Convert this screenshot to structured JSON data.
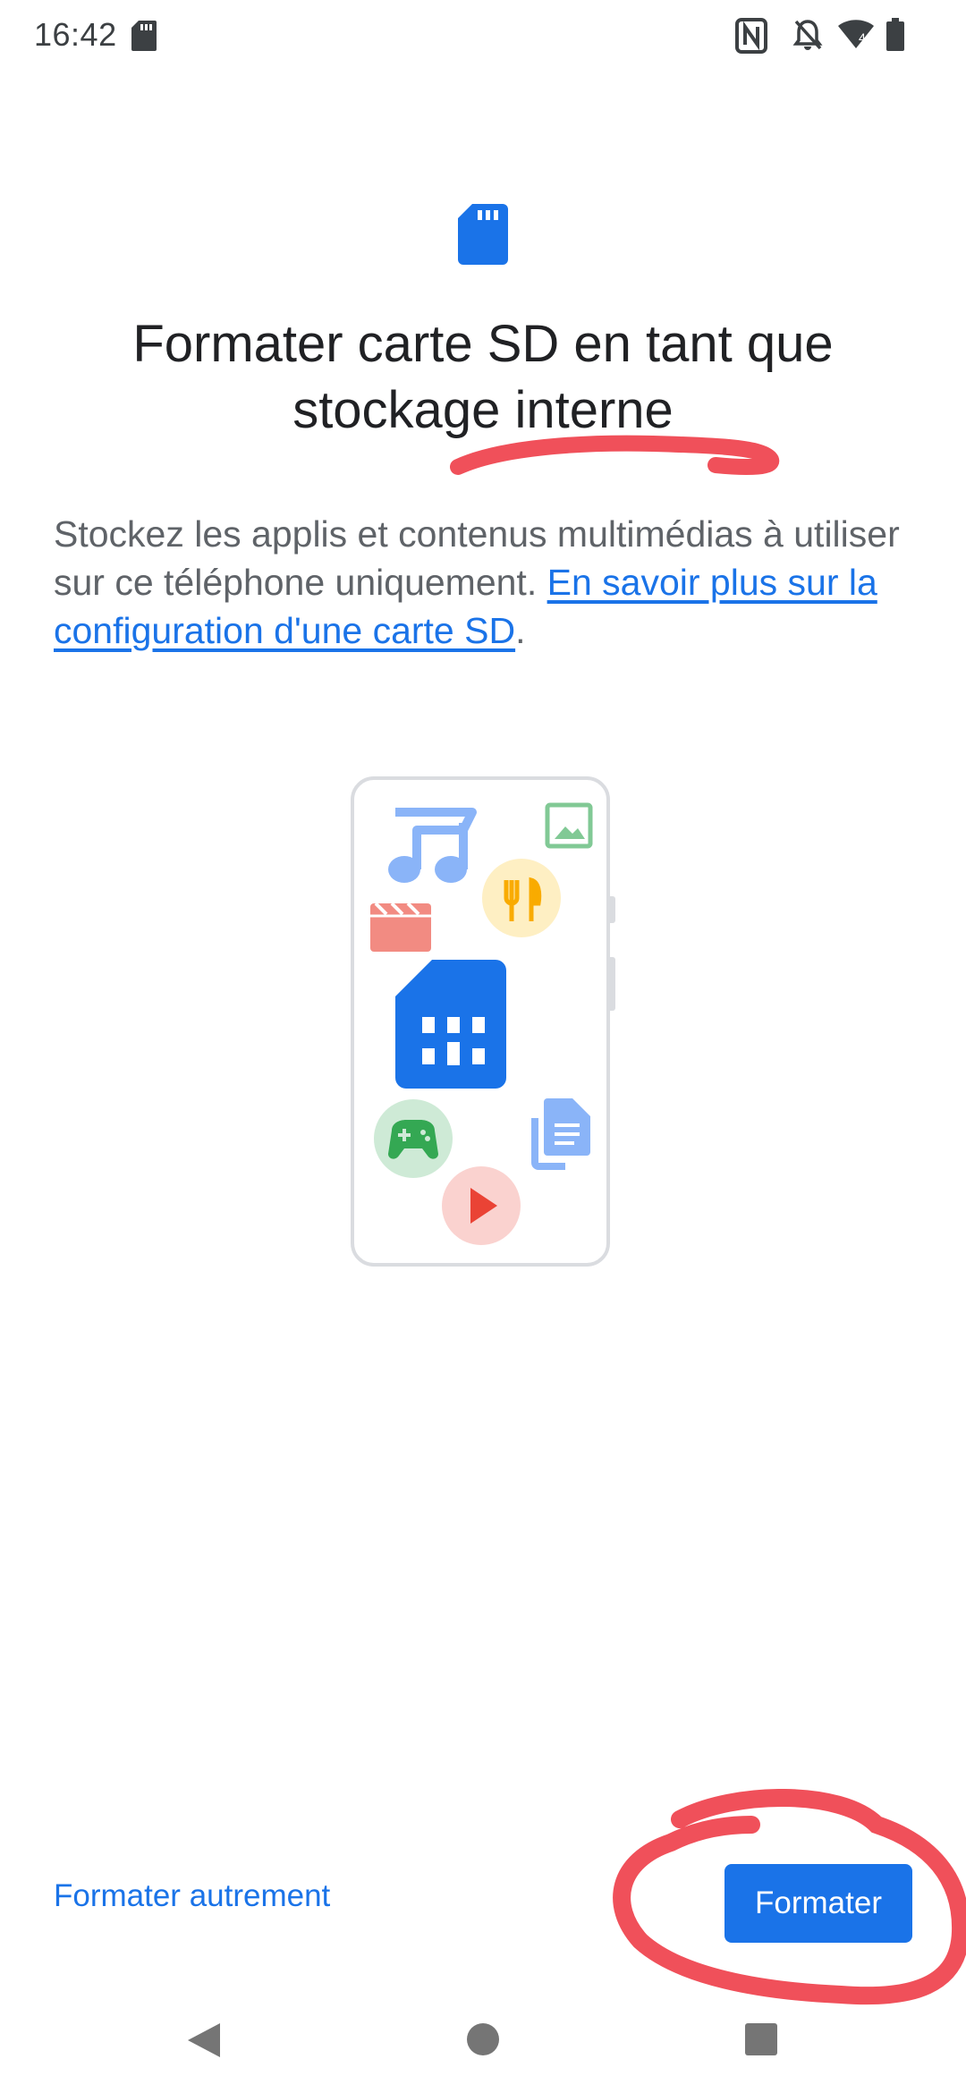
{
  "status_bar": {
    "time": "16:42",
    "left_icons": [
      "sd-card-icon"
    ],
    "right_icons": [
      "nfc-icon",
      "bell-off-icon",
      "wifi-icon",
      "battery-icon"
    ],
    "wifi_badge": "4"
  },
  "header": {
    "icon": "sd-card-icon",
    "title": "Formater carte SD en tant que stockage interne"
  },
  "description": {
    "text": "Stockez les applis et contenus multimédias à utiliser sur ce téléphone uniquement. ",
    "link_text": "En savoir plus sur la configuration d'une carte SD",
    "trailing": "."
  },
  "illustration": {
    "icons": [
      "music-note-icon",
      "image-icon",
      "restaurant-icon",
      "clapperboard-icon",
      "sd-card-icon",
      "gamepad-icon",
      "documents-icon",
      "play-icon"
    ]
  },
  "actions": {
    "secondary_label": "Formater autrement",
    "primary_label": "Formater"
  },
  "navigation": {
    "buttons": [
      "back-icon",
      "home-icon",
      "recents-icon"
    ]
  },
  "colors": {
    "accent": "#1a73e8",
    "annotation": "#f0505a"
  }
}
